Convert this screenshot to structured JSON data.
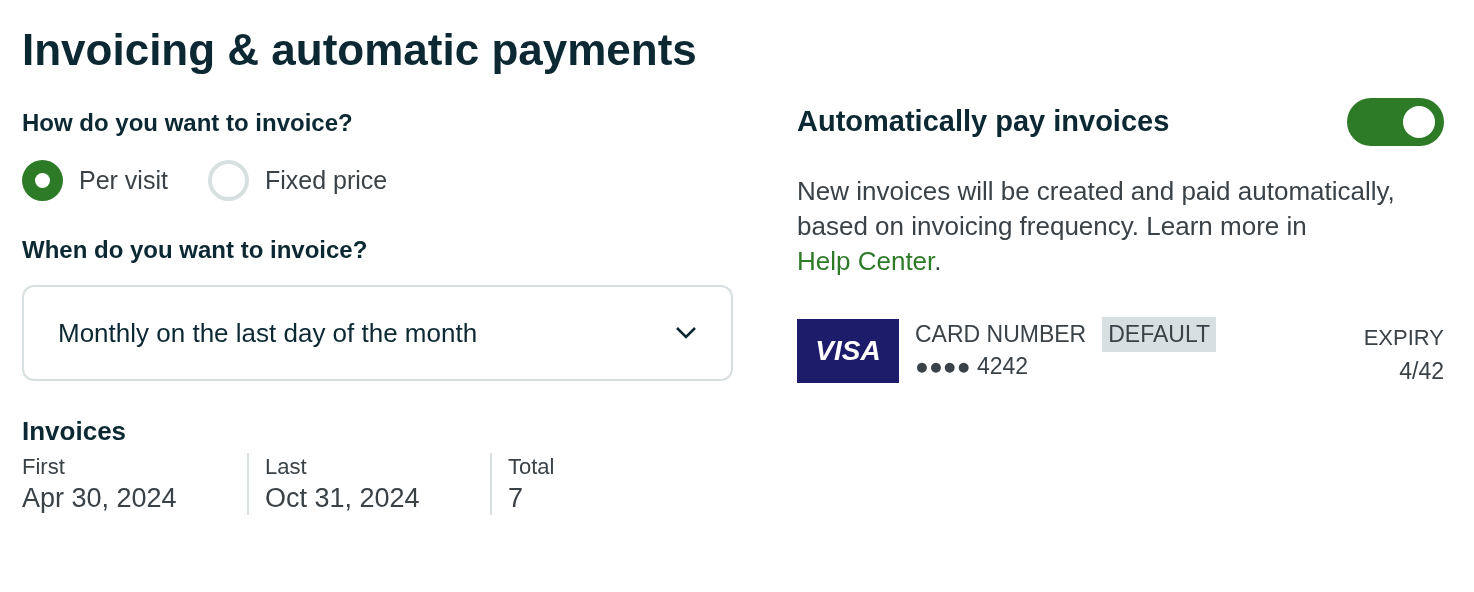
{
  "title": "Invoicing & automatic payments",
  "invoice_method": {
    "question": "How do you want to invoice?",
    "options": [
      {
        "label": "Per visit",
        "selected": true
      },
      {
        "label": "Fixed price",
        "selected": false
      }
    ]
  },
  "invoice_timing": {
    "question": "When do you want to invoice?",
    "value": "Monthly on the last day of the month"
  },
  "invoices": {
    "heading": "Invoices",
    "stats": [
      {
        "label": "First",
        "value": "Apr 30, 2024"
      },
      {
        "label": "Last",
        "value": "Oct 31, 2024"
      },
      {
        "label": "Total",
        "value": "7"
      }
    ]
  },
  "auto_pay": {
    "title": "Automatically pay invoices",
    "on": true,
    "description": "New invoices will be created and paid automatically, based on invoicing frequency. Learn more in ",
    "link": "Help Center",
    "description_end": "."
  },
  "card": {
    "brand": "VISA",
    "number_label": "CARD NUMBER",
    "badge": "DEFAULT",
    "number": "●●●● 4242",
    "expiry_label": "EXPIRY",
    "expiry": "4/42"
  }
}
